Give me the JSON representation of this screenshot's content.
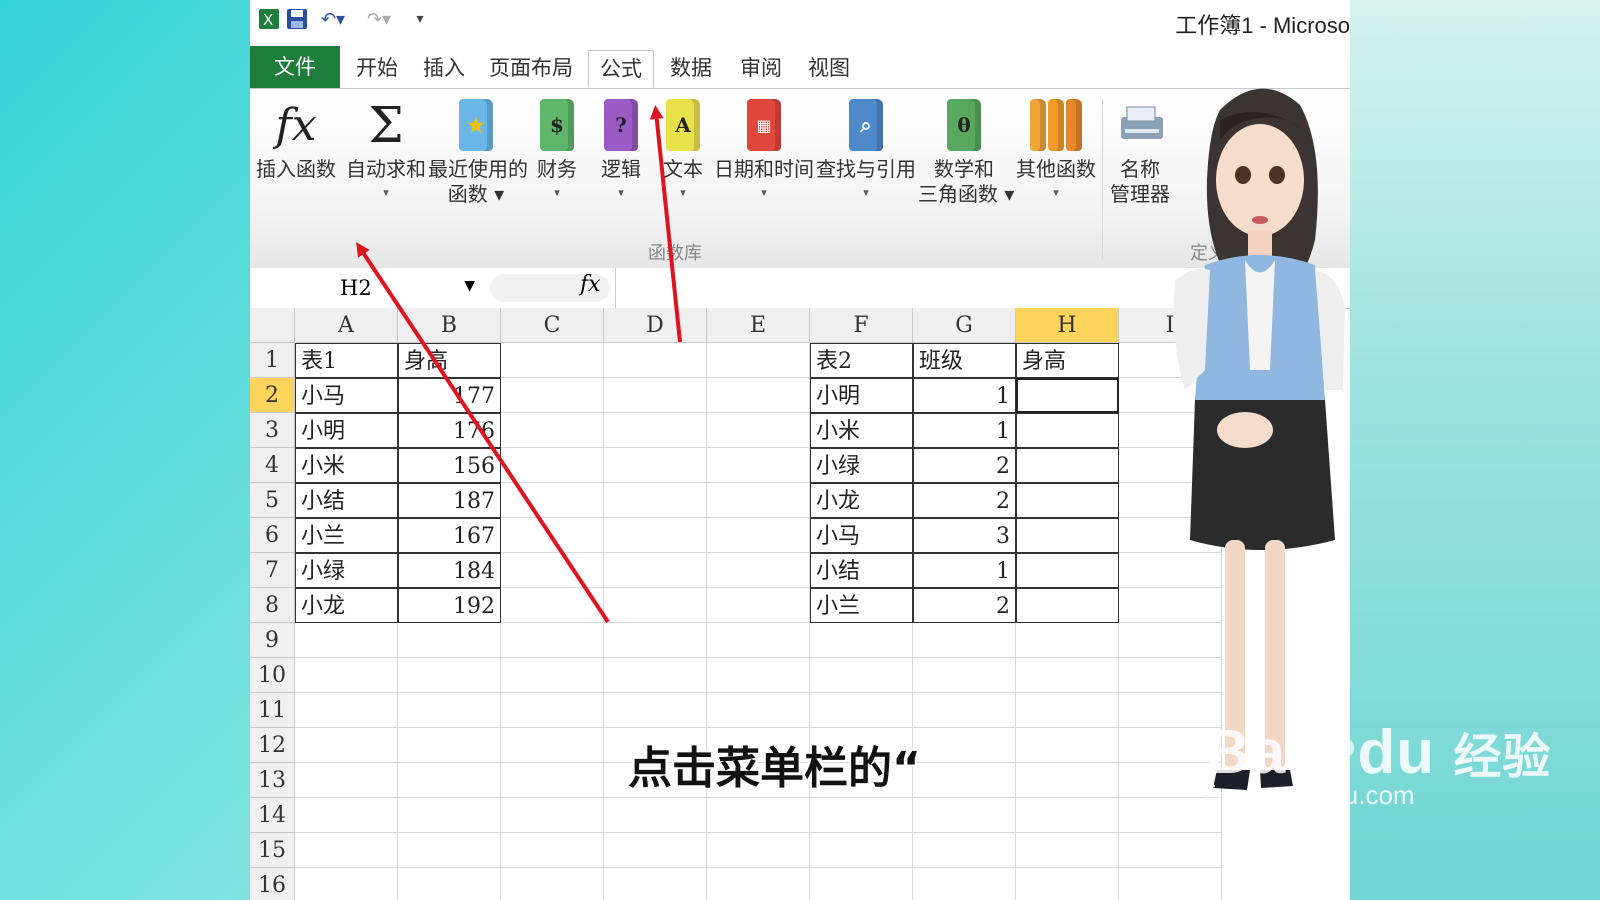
{
  "window": {
    "title": "工作簿1 - Microso"
  },
  "tabs": [
    {
      "label": "文件"
    },
    {
      "label": "开始"
    },
    {
      "label": "插入"
    },
    {
      "label": "页面布局"
    },
    {
      "label": "公式"
    },
    {
      "label": "数据"
    },
    {
      "label": "审阅"
    },
    {
      "label": "视图"
    }
  ],
  "ribbon": {
    "insert_function": "插入函数",
    "autosum": "自动求和",
    "recent_1": "最近使用的",
    "recent_2": "函数",
    "financial": "财务",
    "logical": "逻辑",
    "text": "文本",
    "datetime": "日期和时间",
    "lookup": "查找与引用",
    "math_1": "数学和",
    "math_2": "三角函数",
    "other": "其他函数",
    "name_mgr_1": "名称",
    "name_mgr_2": "管理器",
    "group_function_library": "函数库",
    "group_defined": "定义"
  },
  "formula_bar": {
    "name_box": "H2",
    "fx": "fx"
  },
  "columns": [
    "A",
    "B",
    "C",
    "D",
    "E",
    "F",
    "G",
    "H",
    "I"
  ],
  "selected_column": "H",
  "rows": [
    "1",
    "2",
    "3",
    "4",
    "5",
    "6",
    "7",
    "8",
    "9",
    "10",
    "11",
    "12",
    "13",
    "14",
    "15",
    "16"
  ],
  "selected_row": "2",
  "table1": {
    "header": [
      "表1",
      "身高"
    ],
    "rows": [
      [
        "小马",
        "177"
      ],
      [
        "小明",
        "176"
      ],
      [
        "小米",
        "156"
      ],
      [
        "小结",
        "187"
      ],
      [
        "小兰",
        "167"
      ],
      [
        "小绿",
        "184"
      ],
      [
        "小龙",
        "192"
      ]
    ]
  },
  "table2": {
    "header": [
      "表2",
      "班级",
      "身高"
    ],
    "rows": [
      [
        "小明",
        "1",
        ""
      ],
      [
        "小米",
        "1",
        ""
      ],
      [
        "小绿",
        "2",
        ""
      ],
      [
        "小龙",
        "2",
        ""
      ],
      [
        "小马",
        "3",
        ""
      ],
      [
        "小结",
        "1",
        ""
      ],
      [
        "小兰",
        "2",
        ""
      ]
    ]
  },
  "subtitle": "点击菜单栏的“",
  "watermark": {
    "logo": "Bai",
    "logo2": "du",
    "cn": "经验",
    "url": "jingyan.baidu.com"
  },
  "colors": {
    "file_tab": "#1e7d3a",
    "selected_header": "#ffd45a",
    "arrow": "#e0141e"
  }
}
